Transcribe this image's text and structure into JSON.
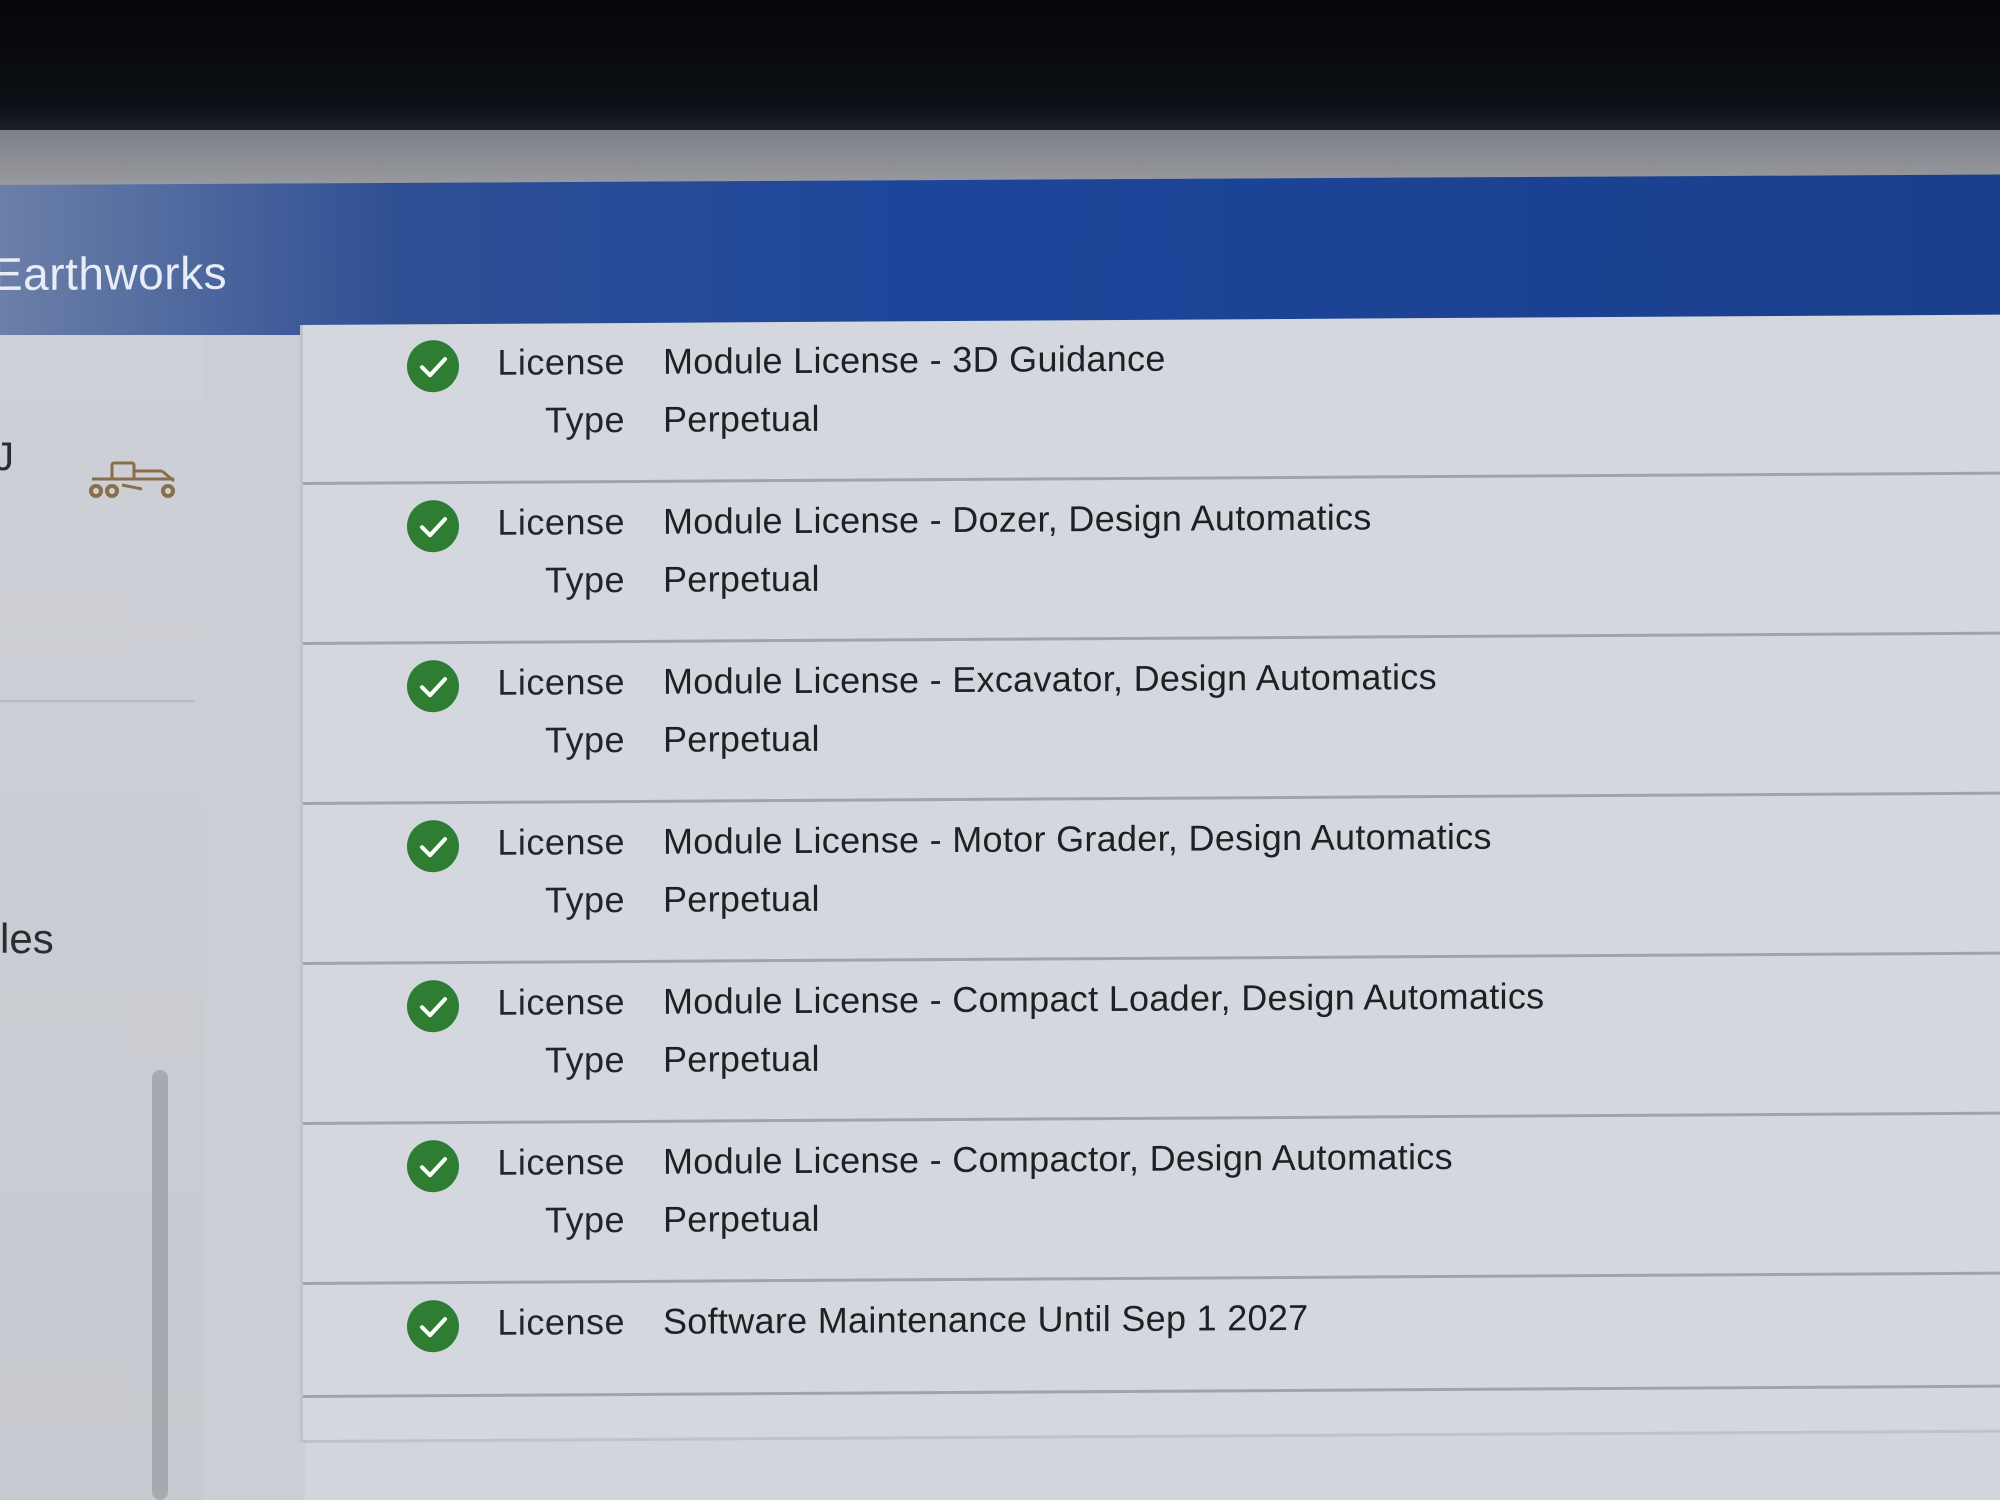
{
  "app": {
    "title": "Earthworks"
  },
  "sidebar": {
    "cut_text_top": "J",
    "machine_icon": "motor-grader-icon",
    "cut_text_label": "les"
  },
  "licenses": [
    {
      "license_label": "License",
      "license_value": "Module License - 3D Guidance",
      "type_label": "Type",
      "type_value": "Perpetual",
      "status": "active",
      "status_icon": "check-circle-icon",
      "status_color": "#2e7d32"
    },
    {
      "license_label": "License",
      "license_value": "Module License - Dozer, Design Automatics",
      "type_label": "Type",
      "type_value": "Perpetual",
      "status": "active",
      "status_icon": "check-circle-icon",
      "status_color": "#2e7d32"
    },
    {
      "license_label": "License",
      "license_value": "Module License - Excavator, Design Automatics",
      "type_label": "Type",
      "type_value": "Perpetual",
      "status": "active",
      "status_icon": "check-circle-icon",
      "status_color": "#2e7d32"
    },
    {
      "license_label": "License",
      "license_value": "Module License - Motor Grader, Design Automatics",
      "type_label": "Type",
      "type_value": "Perpetual",
      "status": "active",
      "status_icon": "check-circle-icon",
      "status_color": "#2e7d32"
    },
    {
      "license_label": "License",
      "license_value": "Module License - Compact Loader, Design Automatics",
      "type_label": "Type",
      "type_value": "Perpetual",
      "status": "active",
      "status_icon": "check-circle-icon",
      "status_color": "#2e7d32"
    },
    {
      "license_label": "License",
      "license_value": "Module License - Compactor, Design Automatics",
      "type_label": "Type",
      "type_value": "Perpetual",
      "status": "active",
      "status_icon": "check-circle-icon",
      "status_color": "#2e7d32"
    },
    {
      "license_label": "License",
      "license_value": "Software Maintenance Until Sep 1 2027",
      "status": "active",
      "status_icon": "check-circle-icon",
      "status_color": "#2e7d32"
    }
  ],
  "colors": {
    "title_bar": "#1d469b",
    "check_green": "#2e7d32",
    "panel_bg": "#d4d7dd"
  }
}
